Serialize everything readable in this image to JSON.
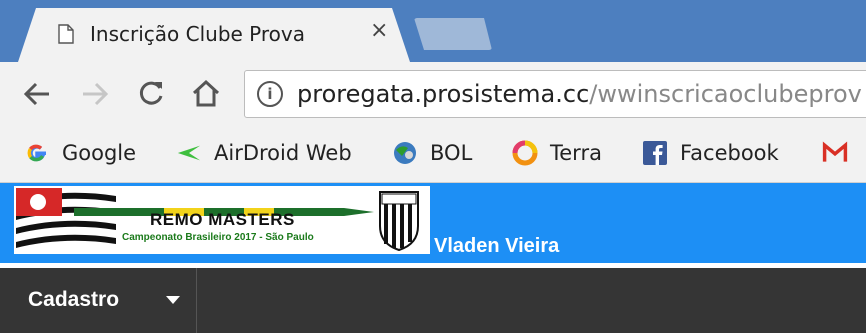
{
  "browser": {
    "tab_title": "Inscrição Clube Prova",
    "tab_close": "×",
    "url_host": "proregata.prosistema.cc",
    "url_path": "/wwinscricaoclubeprov",
    "info_symbol": "i"
  },
  "bookmarks": [
    {
      "label": "Google",
      "icon": "google-icon"
    },
    {
      "label": "AirDroid Web",
      "icon": "airdroid-icon"
    },
    {
      "label": "BOL",
      "icon": "bol-icon"
    },
    {
      "label": "Terra",
      "icon": "terra-icon"
    },
    {
      "label": "Facebook",
      "icon": "facebook-icon"
    },
    {
      "label": "",
      "icon": "gmail-icon"
    }
  ],
  "banner": {
    "logo_title": "REMO MASTERS",
    "logo_subtitle": "Campeonato Brasileiro 2017 - São Paulo",
    "user_name": "Vladen Vieira"
  },
  "menu": {
    "cadastro_label": "Cadastro"
  }
}
